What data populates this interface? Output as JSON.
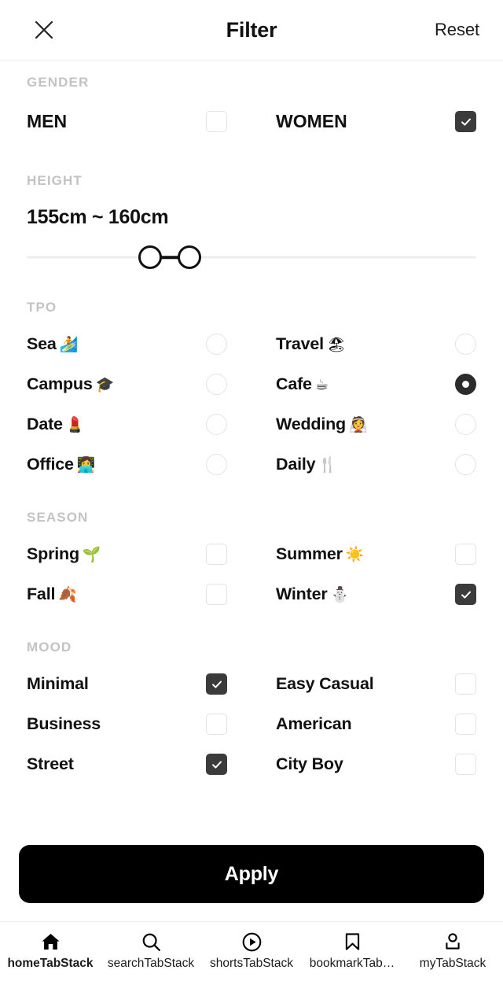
{
  "header": {
    "title": "Filter",
    "reset_label": "Reset",
    "close_icon": "close-icon"
  },
  "sections": {
    "gender": {
      "label": "GENDER",
      "control": "checkbox",
      "options": [
        {
          "label": "MEN",
          "emoji": "",
          "checked": false
        },
        {
          "label": "WOMEN",
          "emoji": "",
          "checked": true
        }
      ]
    },
    "height": {
      "label": "HEIGHT",
      "value_text": "155cm ~ 160cm",
      "min_percent": 27.5,
      "max_percent": 36.2
    },
    "tpo": {
      "label": "TPO",
      "control": "radio",
      "options": [
        {
          "label": "Sea",
          "emoji": "🏄",
          "checked": false
        },
        {
          "label": "Travel",
          "emoji": "🏖",
          "checked": false
        },
        {
          "label": "Campus",
          "emoji": "🎓",
          "checked": false
        },
        {
          "label": "Cafe",
          "emoji": "☕",
          "checked": true
        },
        {
          "label": "Date",
          "emoji": "💄",
          "checked": false
        },
        {
          "label": "Wedding",
          "emoji": "👰",
          "checked": false
        },
        {
          "label": "Office",
          "emoji": "👩‍💻",
          "checked": false
        },
        {
          "label": "Daily",
          "emoji": "🍴",
          "checked": false
        }
      ]
    },
    "season": {
      "label": "SEASON",
      "control": "checkbox",
      "options": [
        {
          "label": "Spring",
          "emoji": "🌱",
          "checked": false
        },
        {
          "label": "Summer",
          "emoji": "☀️",
          "checked": false
        },
        {
          "label": "Fall",
          "emoji": "🍂",
          "checked": false
        },
        {
          "label": "Winter",
          "emoji": "⛄",
          "checked": true
        }
      ]
    },
    "mood": {
      "label": "MOOD",
      "control": "checkbox",
      "options": [
        {
          "label": "Minimal",
          "emoji": "",
          "checked": true
        },
        {
          "label": "Easy Casual",
          "emoji": "",
          "checked": false
        },
        {
          "label": "Business",
          "emoji": "",
          "checked": false
        },
        {
          "label": "American",
          "emoji": "",
          "checked": false
        },
        {
          "label": "Street",
          "emoji": "",
          "checked": true
        },
        {
          "label": "City Boy",
          "emoji": "",
          "checked": false
        }
      ]
    }
  },
  "apply": {
    "label": "Apply"
  },
  "tabbar": {
    "tabs": [
      {
        "label": "homeTabStack",
        "icon": "home-icon",
        "active": true
      },
      {
        "label": "searchTabStack",
        "icon": "search-icon",
        "active": false
      },
      {
        "label": "shortsTabStack",
        "icon": "play-circle-icon",
        "active": false
      },
      {
        "label": "bookmarkTab…",
        "icon": "bookmark-icon",
        "active": false
      },
      {
        "label": "myTabStack",
        "icon": "person-icon",
        "active": false
      }
    ]
  },
  "colors": {
    "accent": "#000000",
    "checked_box": "#3b3b3b",
    "section_label": "#c3c3c3",
    "divider": "#ededed"
  }
}
